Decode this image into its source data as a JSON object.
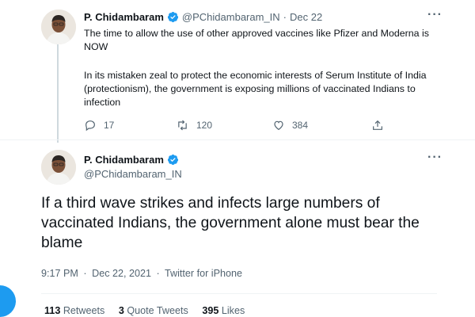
{
  "colors": {
    "accent": "#1d9bf0",
    "muted": "#536471",
    "text": "#0f1419"
  },
  "reply_tweet": {
    "author_name": "P. Chidambaram",
    "handle": "@PChidambaram_IN",
    "separator": "·",
    "date": "Dec 22",
    "text_line1": "The time to allow the use of other approved vaccines like Pfizer and Moderna is NOW",
    "text_line2": "In its mistaken zeal to protect the economic interests of Serum Institute of India (protectionism), the government is exposing millions of vaccinated Indians to infection",
    "replies": "17",
    "retweets": "120",
    "likes": "384",
    "icons": [
      "reply-icon",
      "retweet-icon",
      "like-icon",
      "share-icon",
      "more-icon",
      "verified-badge-icon"
    ]
  },
  "main_tweet": {
    "author_name": "P. Chidambaram",
    "handle": "@PChidambaram_IN",
    "text": "If a third wave strikes and infects large numbers of vaccinated Indians, the government alone must bear the blame",
    "time": "9:17 PM",
    "date": "Dec 22, 2021",
    "separator": "·",
    "source": "Twitter for iPhone",
    "retweets_count": "113",
    "retweets_label": "Retweets",
    "quotes_count": "3",
    "quotes_label": "Quote Tweets",
    "likes_count": "395",
    "likes_label": "Likes"
  }
}
